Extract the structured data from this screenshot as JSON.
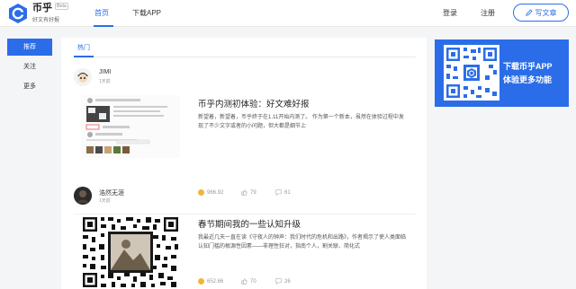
{
  "header": {
    "brand_name": "币乎",
    "beta": "Beta",
    "slogan": "好文有好报",
    "nav": [
      "首页",
      "下载APP"
    ],
    "login": "登录",
    "register": "注册",
    "write_button": "写文章",
    "accent_color": "#2b6de8"
  },
  "left_menu": {
    "items": [
      "推荐",
      "关注",
      "更多"
    ],
    "active_index": 0
  },
  "main": {
    "tab": "热门",
    "posts": [
      {
        "author": "JIMI",
        "time": "1天前",
        "title": "币乎内测初体验：好文难好报",
        "excerpt": "新望着，新望着，币乎终于在1.11开始内测了。 作为第一个新本，虽然在体验过程中发现了不少文字或者的小问题，但大都是细节上",
        "coins": "966.92",
        "likes": "79",
        "comments": "61"
      },
      {
        "author": "浩然无涯",
        "time": "1天前",
        "title": "春节期间我的一些认知升级",
        "excerpt": "我最近几天一直在读《守夜人的钟声：我们时代的危机和出路》，作者揭示了使人类面临认知门槛的根源性因素——非理性狂对，指南个人，割关联、简化式",
        "coins": "652.66",
        "likes": "70",
        "comments": "26"
      }
    ]
  },
  "ad": {
    "line1": "下载币乎APP",
    "line2": "体验更多功能"
  }
}
